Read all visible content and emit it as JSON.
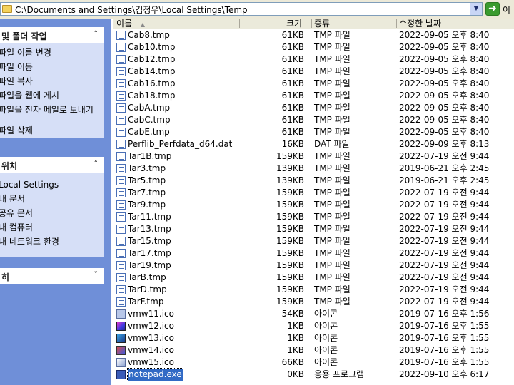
{
  "address": {
    "path": "C:\\Documents and Settings\\김정우\\Local Settings\\Temp",
    "go_label": "이"
  },
  "tasks_panel": {
    "title": "및 폴더 작업",
    "items": [
      "파일 이름 변경",
      "파일 이동",
      "파일 복사",
      "파일을 웹에 게시",
      "파일을 전자 메일로 보내기",
      "파일 삭제"
    ]
  },
  "places_panel": {
    "title": "위치",
    "items": [
      "Local Settings",
      "내 문서",
      "공유 문서",
      "내 컴퓨터",
      "내 네트워크 환경"
    ]
  },
  "details_panel": {
    "title": "히"
  },
  "columns": {
    "name": "이름",
    "size": "크기",
    "type": "종류",
    "date": "수정한 날짜"
  },
  "files": [
    {
      "name": "Cab8.tmp",
      "size": "61KB",
      "type": "TMP 파일",
      "date": "2022-09-05 오후 8:40",
      "icon": "doc"
    },
    {
      "name": "Cab10.tmp",
      "size": "61KB",
      "type": "TMP 파일",
      "date": "2022-09-05 오후 8:40",
      "icon": "doc"
    },
    {
      "name": "Cab12.tmp",
      "size": "61KB",
      "type": "TMP 파일",
      "date": "2022-09-05 오후 8:40",
      "icon": "doc"
    },
    {
      "name": "Cab14.tmp",
      "size": "61KB",
      "type": "TMP 파일",
      "date": "2022-09-05 오후 8:40",
      "icon": "doc"
    },
    {
      "name": "Cab16.tmp",
      "size": "61KB",
      "type": "TMP 파일",
      "date": "2022-09-05 오후 8:40",
      "icon": "doc"
    },
    {
      "name": "Cab18.tmp",
      "size": "61KB",
      "type": "TMP 파일",
      "date": "2022-09-05 오후 8:40",
      "icon": "doc"
    },
    {
      "name": "CabA.tmp",
      "size": "61KB",
      "type": "TMP 파일",
      "date": "2022-09-05 오후 8:40",
      "icon": "doc"
    },
    {
      "name": "CabC.tmp",
      "size": "61KB",
      "type": "TMP 파일",
      "date": "2022-09-05 오후 8:40",
      "icon": "doc"
    },
    {
      "name": "CabE.tmp",
      "size": "61KB",
      "type": "TMP 파일",
      "date": "2022-09-05 오후 8:40",
      "icon": "doc"
    },
    {
      "name": "Perflib_Perfdata_d64.dat",
      "size": "16KB",
      "type": "DAT 파일",
      "date": "2022-09-09 오후 8:13",
      "icon": "doc"
    },
    {
      "name": "Tar1B.tmp",
      "size": "159KB",
      "type": "TMP 파일",
      "date": "2022-07-19 오전 9:44",
      "icon": "doc"
    },
    {
      "name": "Tar3.tmp",
      "size": "139KB",
      "type": "TMP 파일",
      "date": "2019-06-21 오후 2:45",
      "icon": "doc"
    },
    {
      "name": "Tar5.tmp",
      "size": "139KB",
      "type": "TMP 파일",
      "date": "2019-06-21 오후 2:45",
      "icon": "doc"
    },
    {
      "name": "Tar7.tmp",
      "size": "159KB",
      "type": "TMP 파일",
      "date": "2022-07-19 오전 9:44",
      "icon": "doc"
    },
    {
      "name": "Tar9.tmp",
      "size": "159KB",
      "type": "TMP 파일",
      "date": "2022-07-19 오전 9:44",
      "icon": "doc"
    },
    {
      "name": "Tar11.tmp",
      "size": "159KB",
      "type": "TMP 파일",
      "date": "2022-07-19 오전 9:44",
      "icon": "doc"
    },
    {
      "name": "Tar13.tmp",
      "size": "159KB",
      "type": "TMP 파일",
      "date": "2022-07-19 오전 9:44",
      "icon": "doc"
    },
    {
      "name": "Tar15.tmp",
      "size": "159KB",
      "type": "TMP 파일",
      "date": "2022-07-19 오전 9:44",
      "icon": "doc"
    },
    {
      "name": "Tar17.tmp",
      "size": "159KB",
      "type": "TMP 파일",
      "date": "2022-07-19 오전 9:44",
      "icon": "doc"
    },
    {
      "name": "Tar19.tmp",
      "size": "159KB",
      "type": "TMP 파일",
      "date": "2022-07-19 오전 9:44",
      "icon": "doc"
    },
    {
      "name": "TarB.tmp",
      "size": "159KB",
      "type": "TMP 파일",
      "date": "2022-07-19 오전 9:44",
      "icon": "doc"
    },
    {
      "name": "TarD.tmp",
      "size": "159KB",
      "type": "TMP 파일",
      "date": "2022-07-19 오전 9:44",
      "icon": "doc"
    },
    {
      "name": "TarF.tmp",
      "size": "159KB",
      "type": "TMP 파일",
      "date": "2022-07-19 오전 9:44",
      "icon": "doc"
    },
    {
      "name": "vmw11.ico",
      "size": "54KB",
      "type": "아이콘",
      "date": "2019-07-16 오후 1:56",
      "icon": "ico1"
    },
    {
      "name": "vmw12.ico",
      "size": "1KB",
      "type": "아이콘",
      "date": "2019-07-16 오후 1:55",
      "icon": "ico2"
    },
    {
      "name": "vmw13.ico",
      "size": "1KB",
      "type": "아이콘",
      "date": "2019-07-16 오후 1:55",
      "icon": "ico3"
    },
    {
      "name": "vmw14.ico",
      "size": "1KB",
      "type": "아이콘",
      "date": "2019-07-16 오후 1:55",
      "icon": "ico4"
    },
    {
      "name": "vmw15.ico",
      "size": "66KB",
      "type": "아이콘",
      "date": "2019-07-16 오후 1:55",
      "icon": "ico5"
    },
    {
      "name": "notepad.exe",
      "size": "0KB",
      "type": "응용 프로그램",
      "date": "2022-09-10 오후 6:17",
      "icon": "exe",
      "selected": true
    }
  ]
}
